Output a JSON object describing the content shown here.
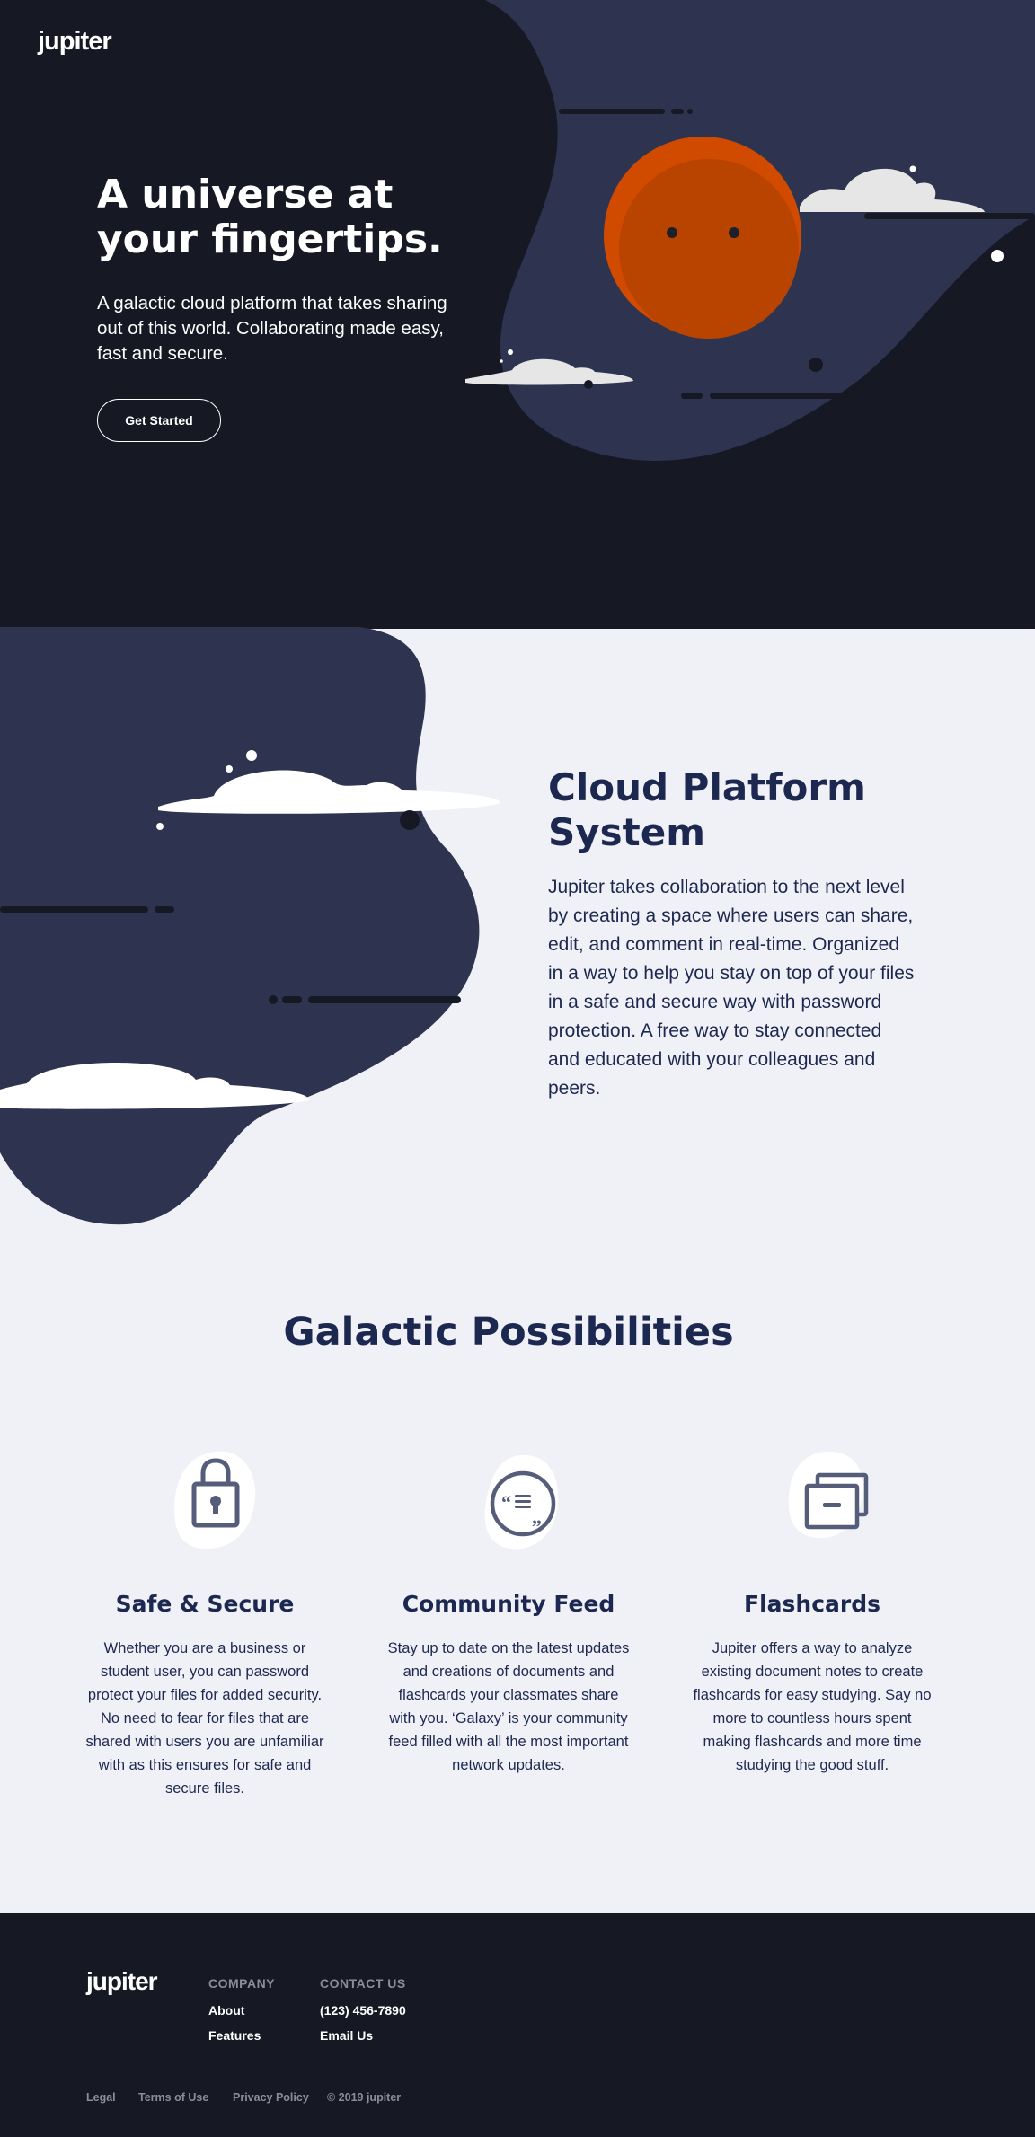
{
  "brand": {
    "logo": "jupiter"
  },
  "hero": {
    "title": "A universe at your fingertips.",
    "subtitle": "A galactic cloud platform that takes sharing out of this world. Collaborating made easy, fast and secure.",
    "cta_label": "Get Started"
  },
  "cloud_platform": {
    "title": "Cloud Platform System",
    "body": "Jupiter takes collaboration to the next level by creating a space where users can share, edit, and comment in real-time. Organized in a way to help you stay on top of your files in a safe and secure way with password protection. A free way to stay connected and educated with your colleagues and peers."
  },
  "features": {
    "title": "Galactic Possibilities",
    "items": [
      {
        "icon": "lock-icon",
        "title": "Safe & Secure",
        "text": "Whether you are a business or student user, you can password protect your files for added security. No need to fear for files that are shared with users you are unfamiliar with as this ensures for safe and secure files."
      },
      {
        "icon": "quote-icon",
        "title": "Community Feed",
        "text": "Stay up to date on the latest updates and creations of documents and flashcards your classmates share with you. ‘Galaxy’ is your community feed filled with all the most important network updates."
      },
      {
        "icon": "flashcards-icon",
        "title": "Flashcards",
        "text": "Jupiter offers a way to analyze existing document notes to create flashcards for easy studying. Say no more to countless hours spent making flashcards and more time studying the good stuff."
      }
    ]
  },
  "footer": {
    "logo": "jupiter",
    "company": {
      "heading": "COMPANY",
      "links": [
        "About",
        "Features"
      ]
    },
    "contact": {
      "heading": "CONTACT US",
      "links": [
        "(123) 456-7890",
        "Email Us"
      ]
    },
    "legal": [
      "Legal",
      "Terms of Use",
      "Privacy Policy",
      "© 2019 jupiter"
    ]
  },
  "colors": {
    "dark_bg": "#161824",
    "blob": "#2e3450",
    "planet": "#c84a00",
    "light_bg": "#f0f1f7",
    "heading_navy": "#1d2850",
    "icon_slate": "#555d7a"
  }
}
